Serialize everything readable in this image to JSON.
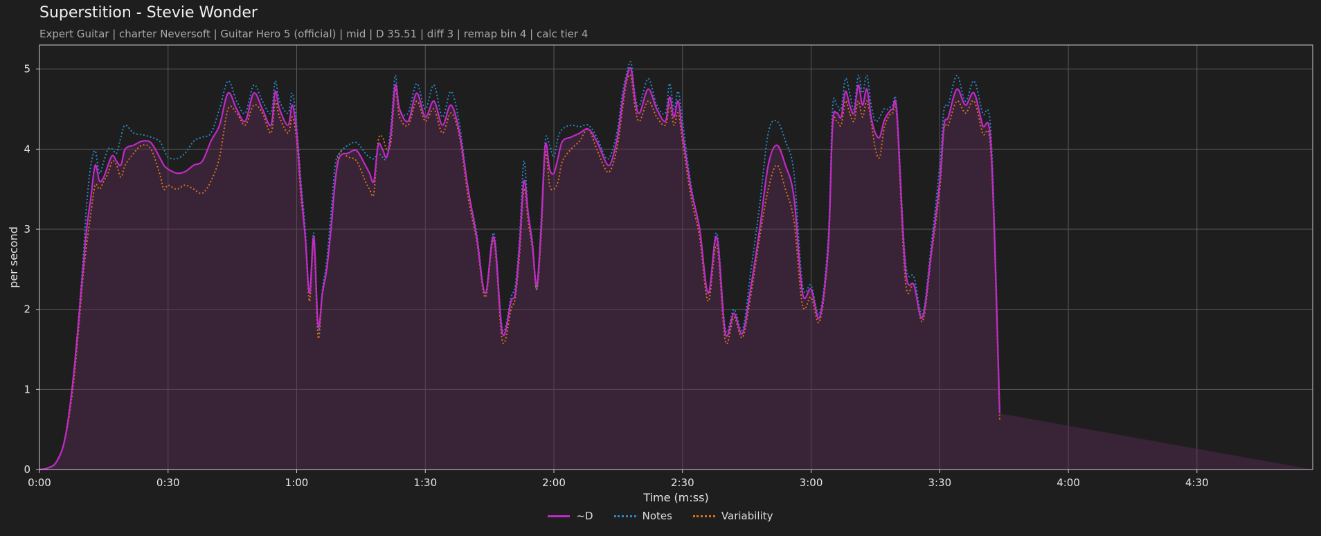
{
  "title": "Superstition - Stevie Wonder",
  "subtitle": "Expert Guitar  |  charter Neversoft  |  Guitar Hero 5 (official)  |  mid  |  D 35.51  |  diff 3  |  remap bin 4  |  calc tier 4",
  "chart_data": {
    "type": "line",
    "xlabel": "Time (m:ss)",
    "ylabel": "per second",
    "x_unit": "m:ss",
    "xlim": [
      "0:00",
      "4:57"
    ],
    "ylim": [
      0,
      5.3
    ],
    "grid": true,
    "legend_position": "bottom-center",
    "x_ticks": [
      "0:00",
      "0:30",
      "1:00",
      "1:30",
      "2:00",
      "2:30",
      "3:00",
      "3:30",
      "4:00",
      "4:30"
    ],
    "y_ticks": [
      "0",
      "1",
      "2",
      "3",
      "4",
      "5"
    ],
    "x": [
      "0:00",
      "0:02",
      "0:04",
      "0:06",
      "0:08",
      "0:10",
      "0:11",
      "0:12",
      "0:13",
      "0:14",
      "0:15",
      "0:16",
      "0:17",
      "0:18",
      "0:19",
      "0:20",
      "0:22",
      "0:24",
      "0:26",
      "0:28",
      "0:29",
      "0:30",
      "0:32",
      "0:34",
      "0:36",
      "0:38",
      "0:40",
      "0:42",
      "0:44",
      "0:46",
      "0:48",
      "0:50",
      "0:52",
      "0:54",
      "0:55",
      "0:56",
      "0:58",
      "0:59",
      "1:00",
      "1:01",
      "1:02",
      "1:03",
      "1:04",
      "1:05",
      "1:06",
      "1:07",
      "1:08",
      "1:09",
      "1:10",
      "1:12",
      "1:14",
      "1:16",
      "1:17",
      "1:18",
      "1:19",
      "1:20",
      "1:21",
      "1:22",
      "1:23",
      "1:24",
      "1:26",
      "1:28",
      "1:30",
      "1:32",
      "1:34",
      "1:36",
      "1:38",
      "1:40",
      "1:42",
      "1:44",
      "1:46",
      "1:48",
      "1:50",
      "1:51",
      "1:52",
      "1:53",
      "1:54",
      "1:55",
      "1:56",
      "1:57",
      "1:58",
      "1:59",
      "2:00",
      "2:01",
      "2:02",
      "2:04",
      "2:06",
      "2:08",
      "2:10",
      "2:12",
      "2:13",
      "2:14",
      "2:15",
      "2:16",
      "2:17",
      "2:18",
      "2:19",
      "2:20",
      "2:22",
      "2:24",
      "2:26",
      "2:27",
      "2:28",
      "2:29",
      "2:30",
      "2:32",
      "2:34",
      "2:36",
      "2:38",
      "2:40",
      "2:42",
      "2:44",
      "2:46",
      "2:48",
      "2:50",
      "2:52",
      "2:54",
      "2:56",
      "2:58",
      "3:00",
      "3:02",
      "3:04",
      "3:05",
      "3:06",
      "3:07",
      "3:08",
      "3:09",
      "3:10",
      "3:11",
      "3:12",
      "3:13",
      "3:14",
      "3:15",
      "3:16",
      "3:17",
      "3:18",
      "3:19",
      "3:20",
      "3:22",
      "3:24",
      "3:26",
      "3:28",
      "3:30",
      "3:31",
      "3:32",
      "3:34",
      "3:36",
      "3:38",
      "3:40",
      "3:42",
      "3:44",
      "3:46",
      "3:48",
      "3:50",
      "3:52",
      "3:53",
      "3:54",
      "3:55",
      "3:56",
      "3:57",
      "3:58",
      "4:00",
      "4:02",
      "4:04",
      "4:05",
      "4:06",
      "4:07",
      "4:08",
      "4:09",
      "4:10",
      "4:11",
      "4:12",
      "4:13",
      "4:14",
      "4:15",
      "4:16",
      "4:18",
      "4:20",
      "4:22",
      "4:24",
      "4:26",
      "4:28",
      "4:30",
      "4:32",
      "4:34",
      "4:36",
      "4:38",
      "4:40",
      "4:42",
      "4:44",
      "4:46",
      "4:47",
      "4:48",
      "4:49",
      "4:50",
      "4:51",
      "4:52",
      "4:53",
      "4:54",
      "4:55",
      "4:56",
      "4:57"
    ],
    "series": [
      {
        "name": "~D",
        "color": "#c02ac8",
        "style": "solid",
        "values": [
          0.0,
          0.02,
          0.1,
          0.4,
          1.2,
          2.4,
          3.0,
          3.4,
          3.8,
          3.6,
          3.65,
          3.8,
          3.92,
          3.85,
          3.8,
          4.0,
          4.05,
          4.1,
          4.08,
          3.9,
          3.8,
          3.75,
          3.7,
          3.72,
          3.8,
          3.85,
          4.1,
          4.3,
          4.7,
          4.5,
          4.35,
          4.7,
          4.5,
          4.3,
          4.72,
          4.5,
          4.3,
          4.55,
          4.2,
          3.5,
          2.9,
          2.2,
          2.9,
          1.8,
          2.2,
          2.5,
          3.0,
          3.6,
          3.9,
          3.95,
          3.98,
          3.8,
          3.7,
          3.6,
          4.05,
          4.0,
          3.9,
          4.2,
          4.8,
          4.5,
          4.35,
          4.7,
          4.4,
          4.6,
          4.3,
          4.55,
          4.2,
          3.5,
          2.9,
          2.2,
          2.9,
          1.7,
          2.1,
          2.2,
          2.8,
          3.6,
          3.2,
          2.8,
          2.3,
          3.0,
          4.05,
          3.75,
          3.7,
          3.9,
          4.1,
          4.15,
          4.2,
          4.25,
          4.1,
          3.85,
          3.8,
          3.95,
          4.2,
          4.6,
          4.9,
          5.0,
          4.6,
          4.45,
          4.75,
          4.5,
          4.35,
          4.65,
          4.4,
          4.6,
          4.2,
          3.5,
          3.0,
          2.2,
          2.9,
          1.7,
          1.95,
          1.7,
          2.3,
          3.0,
          3.8,
          4.05,
          3.8,
          3.4,
          2.2,
          2.25,
          1.9,
          2.8,
          4.3,
          4.45,
          4.4,
          4.72,
          4.55,
          4.45,
          4.8,
          4.55,
          4.75,
          4.4,
          4.2,
          4.15,
          4.35,
          4.45,
          4.5,
          4.45,
          2.5,
          2.3,
          1.9,
          2.7,
          3.6,
          4.3,
          4.4,
          4.75,
          4.55,
          4.7,
          4.3,
          4.0,
          0.7
        ]
      },
      {
        "name": "Notes",
        "color": "#2a88c8",
        "style": "dotted",
        "values": [
          0.0,
          0.02,
          0.1,
          0.4,
          1.2,
          2.5,
          3.3,
          3.8,
          3.98,
          3.7,
          3.85,
          4.0,
          4.0,
          3.95,
          4.15,
          4.3,
          4.2,
          4.18,
          4.15,
          4.1,
          4.0,
          3.9,
          3.88,
          3.95,
          4.1,
          4.15,
          4.2,
          4.5,
          4.85,
          4.6,
          4.45,
          4.8,
          4.6,
          4.45,
          4.85,
          4.6,
          4.45,
          4.7,
          4.3,
          3.6,
          3.0,
          2.2,
          2.95,
          1.75,
          2.25,
          2.6,
          3.2,
          3.8,
          3.95,
          4.05,
          4.08,
          3.95,
          3.9,
          3.88,
          3.95,
          3.9,
          3.9,
          4.3,
          4.92,
          4.5,
          4.45,
          4.82,
          4.5,
          4.8,
          4.4,
          4.72,
          4.3,
          3.5,
          2.95,
          2.2,
          2.95,
          1.75,
          2.15,
          2.3,
          2.9,
          3.85,
          3.2,
          2.85,
          2.25,
          3.1,
          4.1,
          4.05,
          3.9,
          4.15,
          4.25,
          4.3,
          4.28,
          4.3,
          4.15,
          3.9,
          3.9,
          4.05,
          4.3,
          4.7,
          4.95,
          5.08,
          4.65,
          4.55,
          4.88,
          4.55,
          4.45,
          4.82,
          4.5,
          4.72,
          4.35,
          3.55,
          3.0,
          2.2,
          2.95,
          1.75,
          2.0,
          1.75,
          2.5,
          3.3,
          4.2,
          4.35,
          4.1,
          3.7,
          2.3,
          2.3,
          1.95,
          2.9,
          4.5,
          4.55,
          4.5,
          4.88,
          4.7,
          4.5,
          4.92,
          4.7,
          4.92,
          4.55,
          4.35,
          4.4,
          4.5,
          4.5,
          4.55,
          4.5,
          2.6,
          2.4,
          1.95,
          2.8,
          3.8,
          4.5,
          4.55,
          4.92,
          4.6,
          4.85,
          4.45,
          4.15,
          0.7
        ]
      },
      {
        "name": "Variability",
        "color": "#d8751f",
        "style": "dotted",
        "values": [
          0.0,
          0.02,
          0.1,
          0.4,
          1.1,
          2.3,
          2.8,
          3.2,
          3.55,
          3.5,
          3.6,
          3.7,
          3.85,
          3.8,
          3.65,
          3.8,
          3.95,
          4.05,
          4.0,
          3.7,
          3.5,
          3.55,
          3.5,
          3.55,
          3.5,
          3.45,
          3.6,
          3.9,
          4.5,
          4.45,
          4.3,
          4.55,
          4.45,
          4.2,
          4.6,
          4.4,
          4.2,
          4.4,
          4.1,
          3.4,
          2.9,
          2.1,
          2.85,
          1.65,
          2.2,
          2.5,
          3.0,
          3.6,
          3.95,
          3.9,
          3.85,
          3.6,
          3.5,
          3.45,
          4.1,
          4.15,
          4.0,
          4.1,
          4.75,
          4.4,
          4.3,
          4.6,
          4.35,
          4.5,
          4.2,
          4.45,
          4.15,
          3.4,
          2.85,
          2.15,
          2.85,
          1.6,
          2.0,
          2.15,
          2.7,
          3.5,
          3.1,
          2.75,
          2.25,
          2.9,
          3.95,
          3.55,
          3.5,
          3.6,
          3.85,
          4.0,
          4.1,
          4.25,
          4.0,
          3.75,
          3.72,
          3.85,
          4.1,
          4.5,
          4.85,
          4.9,
          4.5,
          4.35,
          4.6,
          4.4,
          4.3,
          4.55,
          4.3,
          4.45,
          4.1,
          3.4,
          2.9,
          2.1,
          2.8,
          1.6,
          1.9,
          1.65,
          2.2,
          2.9,
          3.5,
          3.8,
          3.5,
          3.1,
          2.05,
          2.15,
          1.85,
          2.75,
          4.25,
          4.35,
          4.3,
          4.6,
          4.45,
          4.35,
          4.6,
          4.4,
          4.6,
          4.35,
          4.0,
          3.9,
          4.25,
          4.4,
          4.45,
          4.4,
          2.35,
          2.3,
          1.85,
          2.65,
          3.5,
          4.25,
          4.3,
          4.6,
          4.45,
          4.6,
          4.2,
          3.9,
          0.6
        ]
      }
    ]
  }
}
